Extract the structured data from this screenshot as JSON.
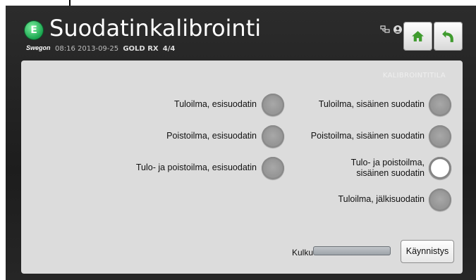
{
  "header": {
    "logo_glyph": "E",
    "title": "Suodatinkalibrointi",
    "brand": "Swegon",
    "time": "08:16",
    "date": "2013-09-25",
    "unit": "GOLD RX",
    "page": "4/4"
  },
  "nav": {
    "home_icon": "home-icon",
    "back_icon": "back-arrow-icon",
    "accent_color": "#3f9b2e"
  },
  "panel": {
    "mode_label": "KALIBROINTITILA",
    "filters_left": [
      {
        "label": "Tuloilma, esisuodatin",
        "active": false
      },
      {
        "label": "Poistoilma, esisuodatin",
        "active": false
      },
      {
        "label": "Tulo- ja poistoilma, esisuodatin",
        "active": false
      }
    ],
    "filters_right": [
      {
        "label": "Tuloilma, sisäinen suodatin",
        "active": false
      },
      {
        "label": "Poistoilma, sisäinen suodatin",
        "active": false
      },
      {
        "label_line1": "Tulo- ja poistoilma,",
        "label_line2": "sisäinen suodatin",
        "active": true
      },
      {
        "label": "Tuloilma, jälkisuodatin",
        "active": false
      }
    ],
    "progress_label": "Kulku",
    "progress_value": 0,
    "start_button": "Käynnistys"
  }
}
